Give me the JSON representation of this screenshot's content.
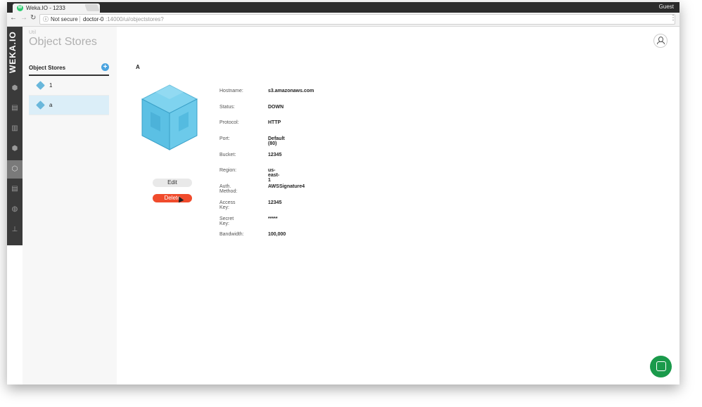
{
  "browser": {
    "tab_title": "Weka.IO - 1233",
    "tab_close": "×",
    "profile": "Guest",
    "security": "Not secure",
    "url_host": "doctor-0",
    "url_path": ":14000/ui/objectstores?"
  },
  "app": {
    "logo": "WEKA.IO",
    "breadcrumb": "Util",
    "page_title": "Object Stores"
  },
  "sidebar": {
    "header": "Object Stores",
    "add_label": "+",
    "items": [
      {
        "label": "1"
      },
      {
        "label": "a"
      }
    ]
  },
  "detail": {
    "title": "A",
    "edit_label": "Edit",
    "delete_label": "Delete",
    "fields": [
      {
        "key": "Hostname:",
        "value": "s3.amazonaws.com"
      },
      {
        "key": "Status:",
        "value": "DOWN"
      },
      {
        "key": "Protocol:",
        "value": "HTTP"
      },
      {
        "key": "Port:",
        "value": "Default (80)"
      },
      {
        "key": "Bucket:",
        "value": "12345"
      },
      {
        "key": "Region:",
        "value": "us-east-1"
      },
      {
        "key": "Auth. Method:",
        "value": "AWSSignature4"
      },
      {
        "key": "Access Key:",
        "value": "12345"
      },
      {
        "key": "Secret Key:",
        "value": "*****"
      },
      {
        "key": "Bandwidth:",
        "value": "100,000"
      }
    ]
  },
  "colors": {
    "accent": "#4aa3df",
    "danger": "#f04b2c",
    "chat": "#1a9a4b"
  }
}
